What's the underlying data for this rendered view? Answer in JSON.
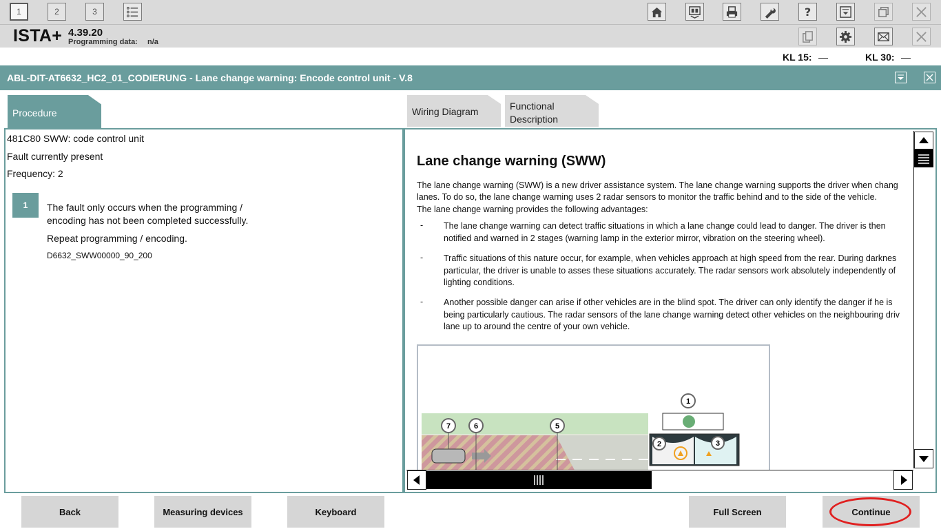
{
  "toolbar": {
    "workspaces": [
      "1",
      "2",
      "3"
    ],
    "icons": [
      "list-icon",
      "home-icon",
      "vehicle-info-icon",
      "print-icon",
      "wrench-icon",
      "help-icon",
      "download-icon",
      "window-restore-icon",
      "close-icon"
    ]
  },
  "app": {
    "name": "ISTA+",
    "version": "4.39.20",
    "programming_label": "Programming data:",
    "programming_value": "n/a",
    "kl15_label": "KL 15:",
    "kl15_value": "—",
    "kl30_label": "KL 30:",
    "kl30_value": "—"
  },
  "header": {
    "title": "ABL-DIT-AT6632_HC2_01_CODIERUNG - Lane change warning: Encode control unit - V.8"
  },
  "tabs": {
    "procedure": "Procedure",
    "wiring": "Wiring Diagram",
    "functional_line1": "Functional",
    "functional_line2": "Description"
  },
  "procedure": {
    "fault_code": "481C80 SWW: code control unit",
    "status": "Fault currently present",
    "frequency": "Frequency: 2",
    "step_number": "1",
    "step_line1": "The fault only occurs when the programming /",
    "step_line2": "encoding has not been completed successfully.",
    "step_action": "Repeat programming / encoding.",
    "step_code": "D6632_SWW00000_90_200"
  },
  "doc": {
    "title": "Lane change warning (SWW)",
    "intro1": "The lane change warning (SWW) is a new driver assistance system. The lane change warning supports the driver when chang",
    "intro2": "lanes. To do so, the lane change warning uses 2 radar sensors to monitor the traffic behind and to the side of the vehicle.",
    "intro3": "The lane change warning provides the following advantages:",
    "b1l1": "The lane change warning can detect traffic situations in which a lane change could lead to danger. The driver is then",
    "b1l2": "notified and warned in 2 stages (warning lamp in the exterior mirror, vibration on the steering wheel).",
    "b2l1": "Traffic situations of this nature occur, for example, when vehicles approach at high speed from the rear. During darknes",
    "b2l2": "particular, the driver is unable to asses these situations accurately. The radar sensors work absolutely independently of",
    "b2l3": "lighting conditions.",
    "b3l1": "Another possible danger can arise if other vehicles are in the blind spot. The driver can only identify the danger if he is",
    "b3l2": "being particularly cautious. The radar sensors of the lane change warning detect other vehicles on the neighbouring driv",
    "b3l3": "lane up to around the centre of your own vehicle.",
    "dash": "-",
    "figure_callouts": [
      "7",
      "6",
      "5",
      "1",
      "2",
      "3"
    ]
  },
  "buttons": {
    "back": "Back",
    "measuring": "Measuring devices",
    "keyboard": "Keyboard",
    "fullscreen": "Full Screen",
    "continue": "Continue"
  },
  "colors": {
    "teal": "#6a9d9d",
    "toolbar_bg": "#dadada",
    "button_bg": "#d6d6d6",
    "highlight_ring": "#e02020"
  }
}
